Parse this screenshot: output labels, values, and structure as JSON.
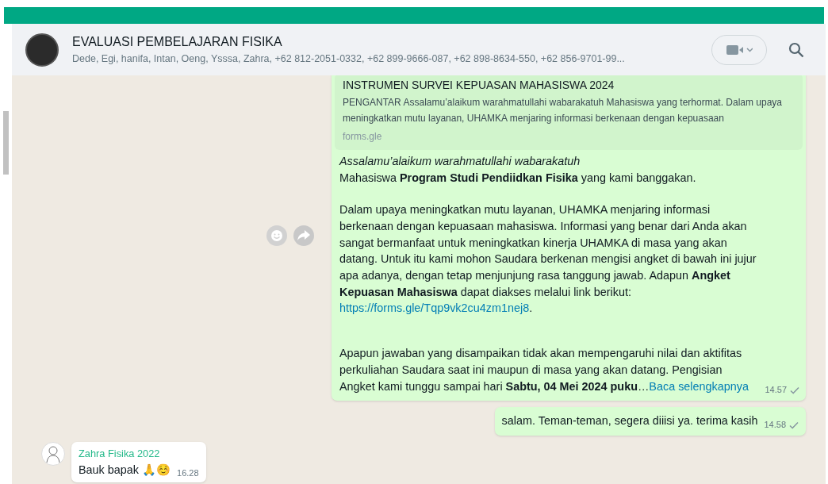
{
  "header": {
    "title": "EVALUASI PEMBELAJARAN FISIKA",
    "members": "Dede, Egi, hanifa, Intan, Oeng, Ysssa, Zahra, +62 812-2051-0332, +62 899-9666-087, +62 898-8634-550, +62 856-9701-99..."
  },
  "messages": [
    {
      "kind": "outgoing",
      "preview": {
        "title": "INSTRUMEN SURVEI KEPUASAN MAHASISWA 2024",
        "description": "PENGANTAR Assalamu’alaikum warahmatullahi wabarakatuh Mahasiswa yang terhormat. Dalam upaya meningkatkan mutu layanan, UHAMKA menjaring informasi berkenaan dengan kepuasaan",
        "domain": "forms.gle"
      },
      "paragraphs": [
        [
          {
            "kind": "text",
            "text": "*Assalamu’alaikum warahmatullahi wabarakatuh*\nMahasiswa **Program Studi Pendiidkan Fisika** yang kami banggakan."
          }
        ],
        [
          {
            "kind": "text",
            "text": "Dalam upaya meningkatkan mutu layanan, UHAMKA menjaring informasi berkenaan dengan kepuasaan mahasiswa.  Informasi yang benar dari Anda akan sangat bermanfaat untuk meningkatkan kinerja UHAMKA di masa yang akan datang. Untuk itu kami mohon Saudara berkenan mengisi angket di bawah ini jujur apa adanya, dengan tetap menjunjung rasa tanggung jawab. Adapun **Angket Kepuasan Mahasiswa** dapat diakses melalui link berikut: "
          },
          {
            "kind": "link",
            "text": "https://forms.gle/Tqp9vk2cu4zm1nej8"
          },
          {
            "kind": "text",
            "text": "."
          }
        ],
        [
          {
            "kind": "text",
            "text": "Apapun jawaban yang disampaikan tidak akan mempengaruhi nilai dan aktifitas perkuliahan Saudara saat ini maupun di masa yang akan datang. Pengisian Angket kami tunggu sampai hari **Sabtu, 04 Mei 2024 puku**…"
          },
          {
            "kind": "link",
            "text": "Baca selengkapnya"
          }
        ]
      ],
      "time": "14.57",
      "read": false,
      "hovered": true
    },
    {
      "kind": "outgoing",
      "paragraphs": [
        [
          {
            "kind": "text",
            "text": "salam. Teman-teman, segera diiisi ya. terima kasih"
          }
        ]
      ],
      "time": "14.58",
      "read": false,
      "hovered": false
    },
    {
      "kind": "incoming",
      "sender": "Zahra Fisika 2022",
      "color": "#25b98a",
      "paragraphs": [
        [
          {
            "kind": "text",
            "text": "Bauk bapak 🙏☺️"
          }
        ]
      ],
      "time": "16.28"
    }
  ]
}
